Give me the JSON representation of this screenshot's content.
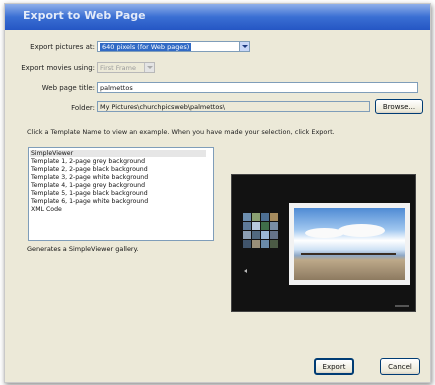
{
  "window": {
    "title": "Export to Web Page"
  },
  "export_pictures": {
    "label": "Export pictures at:",
    "value": "640 pixels (for Web pages)"
  },
  "export_movies": {
    "label": "Export movies using:",
    "value": "First Frame"
  },
  "web_page_title": {
    "label": "Web page title:",
    "value": "palmettos"
  },
  "folder": {
    "label": "Folder:",
    "value": "My Pictures\\churchpicsweb\\palmettos\\",
    "browse_label": "Browse..."
  },
  "instruction": "Click a Template Name to view an example.  When you have made your selection, click Export.",
  "templates": [
    "SimpleViewer",
    "Template 1, 2-page grey background",
    "Template 2, 2-page black background",
    "Template 3, 2-page white background",
    "Template 4, 1-page grey background",
    "Template 5, 1-page black background",
    "Template 6, 1-page white background",
    "XML Code"
  ],
  "selected_template_index": 0,
  "status": "Generates a SimpleViewer gallery.",
  "buttons": {
    "export": "Export",
    "cancel": "Cancel"
  },
  "colors": {
    "titlebar": "#2556c4",
    "dialog_bg": "#ece9d8",
    "selection": "#316ac5",
    "preview_bg": "#121212"
  }
}
